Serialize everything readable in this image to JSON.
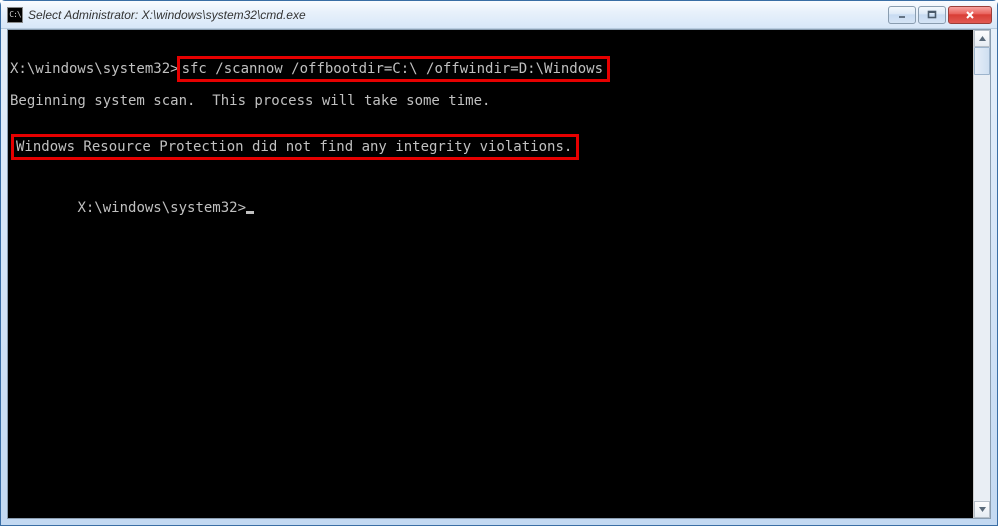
{
  "window": {
    "title": "Select Administrator: X:\\windows\\system32\\cmd.exe",
    "icon_text": "C:\\"
  },
  "console": {
    "prompt1_prefix": "X:\\windows\\system32>",
    "command": "sfc /scannow /offbootdir=C:\\ /offwindir=D:\\Windows",
    "scan_msg": "Beginning system scan.  This process will take some time.",
    "result_msg": "Windows Resource Protection did not find any integrity violations.",
    "prompt2": "X:\\windows\\system32>"
  }
}
